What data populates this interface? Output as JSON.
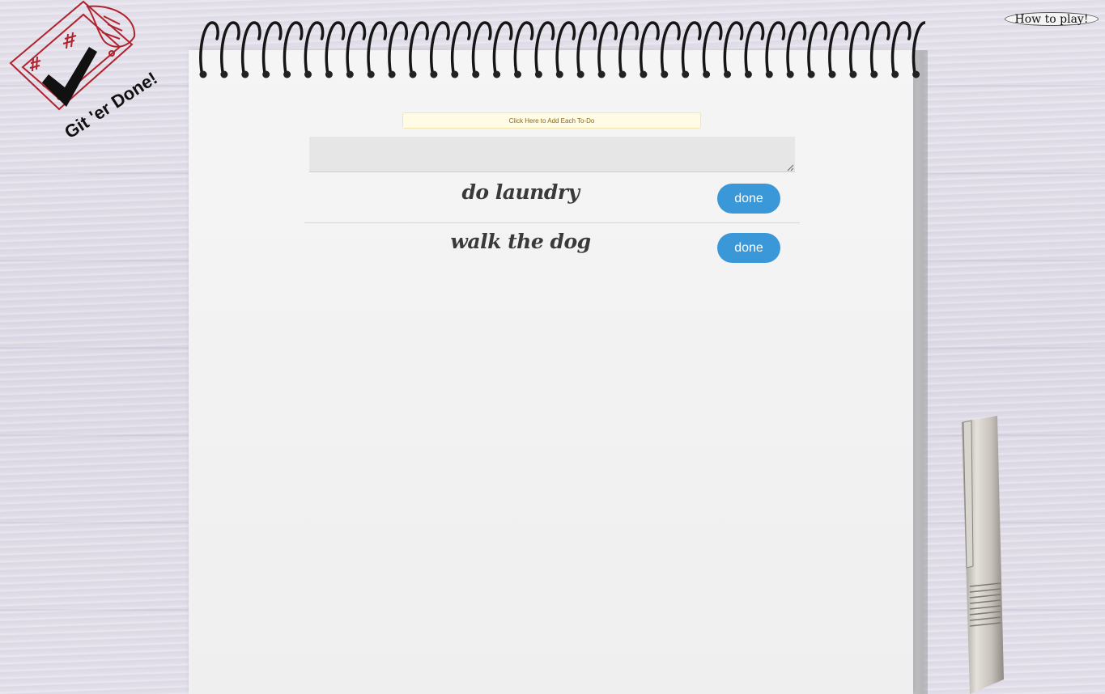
{
  "header": {
    "logo_text": "Git 'er Done!",
    "how_to_play_label": "How to play!"
  },
  "form": {
    "add_button_label": "Click Here to Add Each To-Do",
    "input_value": ""
  },
  "todos": [
    {
      "text": "do laundry",
      "button_label": "done"
    },
    {
      "text": "walk the dog",
      "button_label": "done"
    }
  ],
  "colors": {
    "done_button": "#3a97d8",
    "add_button_bg": "#fffbe4",
    "logo_red": "#b0222e"
  }
}
